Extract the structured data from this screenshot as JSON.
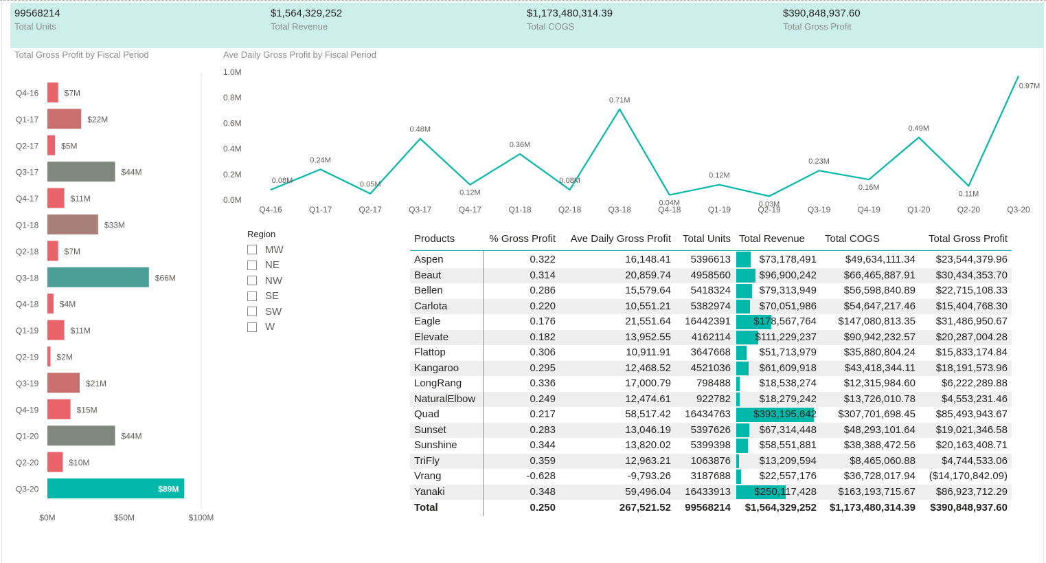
{
  "kpis": [
    {
      "value": "99568214",
      "label": "Total Units"
    },
    {
      "value": "$1,564,329,252",
      "label": "Total Revenue"
    },
    {
      "value": "$1,173,480,314.39",
      "label": "Total COGS"
    },
    {
      "value": "$390,848,937.60",
      "label": "Total Gross Profit"
    }
  ],
  "bar_title": "Total Gross Profit by Fiscal Period",
  "line_title": "Ave Daily Gross Profit by Fiscal Period",
  "colors": {
    "teal": "#01b8aa",
    "dark_teal": "#4a9e95",
    "red": "#e8646a",
    "dark_red": "#c96f6d",
    "grey": "#7f877f",
    "brown": "#a98079",
    "kpi_band": "#ccefec"
  },
  "chart_data": [
    {
      "type": "bar",
      "orientation": "horizontal",
      "title": "Total Gross Profit by Fiscal Period",
      "categories": [
        "Q4-16",
        "Q1-17",
        "Q2-17",
        "Q3-17",
        "Q4-17",
        "Q1-18",
        "Q2-18",
        "Q3-18",
        "Q4-18",
        "Q1-19",
        "Q2-19",
        "Q3-19",
        "Q4-19",
        "Q1-20",
        "Q2-20",
        "Q3-20"
      ],
      "values": [
        7,
        22,
        5,
        44,
        11,
        33,
        7,
        66,
        4,
        11,
        2,
        21,
        15,
        44,
        10,
        89
      ],
      "data_labels": [
        "$7M",
        "$22M",
        "$5M",
        "$44M",
        "$11M",
        "$33M",
        "$7M",
        "$66M",
        "$4M",
        "$11M",
        "$2M",
        "$21M",
        "$15M",
        "$44M",
        "$10M",
        "$89M"
      ],
      "bar_colors": [
        "#e8646a",
        "#c96f6d",
        "#e8646a",
        "#7f877f",
        "#e8646a",
        "#a98079",
        "#e8646a",
        "#4a9e95",
        "#e8646a",
        "#e8646a",
        "#e8646a",
        "#c96f6d",
        "#e8646a",
        "#7f877f",
        "#e8646a",
        "#01b8aa"
      ],
      "xlim": [
        0,
        100
      ],
      "x_ticks": [
        "$0M",
        "$50M",
        "$100M"
      ],
      "grid": false
    },
    {
      "type": "line",
      "title": "Ave Daily Gross Profit by Fiscal Period",
      "categories": [
        "Q4-16",
        "Q1-17",
        "Q2-17",
        "Q3-17",
        "Q4-17",
        "Q1-18",
        "Q2-18",
        "Q3-18",
        "Q4-18",
        "Q1-19",
        "Q2-19",
        "Q3-19",
        "Q4-19",
        "Q1-20",
        "Q2-20",
        "Q3-20"
      ],
      "values": [
        0.08,
        0.24,
        0.05,
        0.48,
        0.12,
        0.36,
        0.08,
        0.71,
        0.04,
        0.12,
        0.03,
        0.23,
        0.16,
        0.49,
        0.11,
        0.97
      ],
      "data_labels": [
        "0.08M",
        "0.24M",
        "0.05M",
        "0.48M",
        "0.12M",
        "0.36M",
        "0.08M",
        "0.71M",
        "0.04M",
        "0.12M",
        "0.03M",
        "0.23M",
        "0.16M",
        "0.49M",
        "0.11M",
        "0.97M"
      ],
      "ylim": [
        0,
        1.0
      ],
      "y_ticks": [
        0,
        0.2,
        0.4,
        0.6,
        0.8,
        1.0
      ],
      "y_tick_labels": [
        "0.0M",
        "0.2M",
        "0.4M",
        "0.6M",
        "0.8M",
        "1.0M"
      ],
      "grid": false,
      "line_color": "#01b8aa"
    }
  ],
  "slicer": {
    "title": "Region",
    "items": [
      "MW",
      "NE",
      "NW",
      "SE",
      "SW",
      "W"
    ]
  },
  "matrix": {
    "headers": [
      "Products",
      "% Gross Profit",
      "Ave Daily Gross Profit",
      "Total Units",
      "Total Revenue",
      "Total COGS",
      "Total Gross Profit"
    ],
    "rows": [
      {
        "product": "Aspen",
        "pct": "0.322",
        "ave": "16,148.41",
        "units": "5396613",
        "revenue": "$73,178,491",
        "rev_value": 73178491,
        "cogs": "$49,634,111.34",
        "gp": "$23,544,379.96"
      },
      {
        "product": "Beaut",
        "pct": "0.314",
        "ave": "20,859.74",
        "units": "4958560",
        "revenue": "$96,900,242",
        "rev_value": 96900242,
        "cogs": "$66,465,887.91",
        "gp": "$30,434,353.70"
      },
      {
        "product": "Bellen",
        "pct": "0.286",
        "ave": "15,579.64",
        "units": "5418324",
        "revenue": "$79,313,949",
        "rev_value": 79313949,
        "cogs": "$56,598,840.89",
        "gp": "$22,715,108.33"
      },
      {
        "product": "Carlota",
        "pct": "0.220",
        "ave": "10,551.21",
        "units": "5382974",
        "revenue": "$70,051,986",
        "rev_value": 70051986,
        "cogs": "$54,647,217.46",
        "gp": "$15,404,768.30"
      },
      {
        "product": "Eagle",
        "pct": "0.176",
        "ave": "21,551.64",
        "units": "16442391",
        "revenue": "$178,567,764",
        "rev_value": 178567764,
        "cogs": "$147,080,813.35",
        "gp": "$31,486,950.67"
      },
      {
        "product": "Elevate",
        "pct": "0.182",
        "ave": "13,952.55",
        "units": "4162114",
        "revenue": "$111,229,237",
        "rev_value": 111229237,
        "cogs": "$90,942,232.57",
        "gp": "$20,287,004.28"
      },
      {
        "product": "Flattop",
        "pct": "0.306",
        "ave": "10,911.91",
        "units": "3647668",
        "revenue": "$51,713,979",
        "rev_value": 51713979,
        "cogs": "$35,880,804.24",
        "gp": "$15,833,174.84"
      },
      {
        "product": "Kangaroo",
        "pct": "0.295",
        "ave": "12,468.52",
        "units": "4521036",
        "revenue": "$61,609,918",
        "rev_value": 61609918,
        "cogs": "$43,418,344.11",
        "gp": "$18,191,573.96"
      },
      {
        "product": "LongRang",
        "pct": "0.336",
        "ave": "17,000.79",
        "units": "798488",
        "revenue": "$18,538,274",
        "rev_value": 18538274,
        "cogs": "$12,315,984.60",
        "gp": "$6,222,289.88"
      },
      {
        "product": "NaturalElbow",
        "pct": "0.249",
        "ave": "12,474.61",
        "units": "922782",
        "revenue": "$18,279,242",
        "rev_value": 18279242,
        "cogs": "$13,726,010.78",
        "gp": "$4,553,231.46"
      },
      {
        "product": "Quad",
        "pct": "0.217",
        "ave": "58,517.42",
        "units": "16434763",
        "revenue": "$393,195,642",
        "rev_value": 393195642,
        "cogs": "$307,701,698.45",
        "gp": "$85,493,943.67"
      },
      {
        "product": "Sunset",
        "pct": "0.283",
        "ave": "13,046.19",
        "units": "5397626",
        "revenue": "$67,314,448",
        "rev_value": 67314448,
        "cogs": "$48,293,101.64",
        "gp": "$19,021,346.58"
      },
      {
        "product": "Sunshine",
        "pct": "0.344",
        "ave": "13,820.02",
        "units": "5399398",
        "revenue": "$58,551,881",
        "rev_value": 58551881,
        "cogs": "$38,388,472.56",
        "gp": "$20,163,408.71"
      },
      {
        "product": "TriFly",
        "pct": "0.359",
        "ave": "12,963.21",
        "units": "1063876",
        "revenue": "$13,209,594",
        "rev_value": 13209594,
        "cogs": "$8,465,060.88",
        "gp": "$4,744,533.06"
      },
      {
        "product": "Vrang",
        "pct": "-0.628",
        "ave": "-9,793.26",
        "units": "3187688",
        "revenue": "$22,557,176",
        "rev_value": 22557176,
        "cogs": "$36,728,017.94",
        "gp": "($14,170,842.09)"
      },
      {
        "product": "Yanaki",
        "pct": "0.348",
        "ave": "59,496.04",
        "units": "16433913",
        "revenue": "$250,117,428",
        "rev_value": 250117428,
        "cogs": "$163,193,715.67",
        "gp": "$86,923,712.29"
      }
    ],
    "total": {
      "product": "Total",
      "pct": "0.250",
      "ave": "267,521.52",
      "units": "99568214",
      "revenue": "$1,564,329,252",
      "cogs": "$1,173,480,314.39",
      "gp": "$390,848,937.60"
    }
  }
}
